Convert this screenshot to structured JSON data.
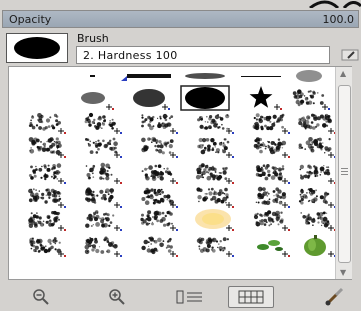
{
  "opacity": {
    "label": "Opacity",
    "value": "100.0"
  },
  "brush": {
    "label": "Brush",
    "name": "2. Hardness 100"
  },
  "brushes": [
    [
      "line-small",
      "line-long",
      "blur-wide",
      "line-thin",
      "blur-soft"
    ],
    [
      "blur-small",
      "blur-medium",
      "hardness-100",
      "star",
      "splatter-1"
    ],
    [
      "spray-1",
      "spray-2",
      "spray-3",
      "spray-4",
      "spray-5",
      "spray-6"
    ],
    [
      "spray-7",
      "spray-8",
      "spray-9",
      "spray-10",
      "spray-11",
      "spray-12"
    ],
    [
      "texture-1",
      "texture-2",
      "texture-3",
      "texture-4",
      "texture-5",
      "texture-6"
    ],
    [
      "texture-7",
      "texture-8",
      "texture-9",
      "texture-10",
      "texture-11",
      "texture-12"
    ],
    [
      "texture-13",
      "texture-14",
      "texture-15",
      "glow",
      "texture-16",
      "texture-17"
    ],
    [
      "texture-18",
      "texture-19",
      "texture-20",
      "texture-21",
      "leaves",
      "pepper"
    ]
  ],
  "toolbar": {
    "icons": [
      "zoom-out-icon",
      "zoom-in-icon",
      "list-view-icon",
      "grid-view-icon",
      "paint-brush-icon"
    ]
  }
}
